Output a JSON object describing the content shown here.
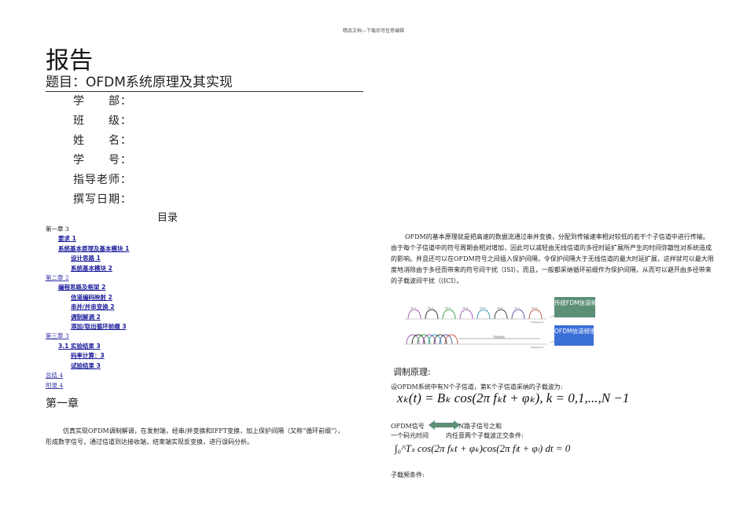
{
  "header": "精品文档---下载后可任意编辑",
  "title": "报告",
  "topic": "题目：OFDM系统原理及其实现",
  "fields": [
    "学　　部：",
    "班　　级：",
    "姓　　名：",
    "学　　号：",
    "指导老师：",
    "撰写日期："
  ],
  "toc": {
    "title": "目录",
    "items": [
      {
        "text": "第一章 3",
        "level": 0,
        "style": "plain"
      },
      {
        "text": "要求 1",
        "level": 1,
        "style": "bold"
      },
      {
        "text": "系统基本原理及基本模块 1",
        "level": 1,
        "style": "bold"
      },
      {
        "text": "设计思路 1",
        "level": 2,
        "style": "bold"
      },
      {
        "text": "系统基本模块 2",
        "level": 2,
        "style": "bold"
      },
      {
        "text": "第二章 2",
        "level": 0,
        "style": "link"
      },
      {
        "text": "编程思路及框架 2",
        "level": 1,
        "style": "bold"
      },
      {
        "text": "信道编码映射 2",
        "level": 2,
        "style": "bold"
      },
      {
        "text": "串并/并串变换 2",
        "level": 2,
        "style": "bold"
      },
      {
        "text": "调制解调 2",
        "level": 2,
        "style": "bold"
      },
      {
        "text": "添加/取出循环前缀 3",
        "level": 2,
        "style": "bold"
      },
      {
        "text": "第三章 3",
        "level": 0,
        "style": "link"
      },
      {
        "text": "3.1 实验结果 3",
        "level": 1,
        "style": "bold"
      },
      {
        "text": "码率计算：3",
        "level": 2,
        "style": "bold"
      },
      {
        "text": "试验结果 3",
        "level": 2,
        "style": "bold"
      },
      {
        "text": "总结 4",
        "level": 0,
        "style": "link"
      },
      {
        "text": "附录 4",
        "level": 0,
        "style": "link"
      }
    ]
  },
  "chapter1": {
    "heading": "第一章",
    "paragraph": "仿真实现OFDM调制解调，在发射端，经串/并变换和IFFT变换，加上保护间隔（又称“循环前缀”），形成数字信号，通过信道到达接收端，结束端实现反变换，进行误码分析。"
  },
  "right": {
    "paragraph": "OFDM的基本原理就是把高速的数据流通过串并变换，分配到传输速率相对较低的若干个子信道中进行传输。由于每个子信道中的符号周期会相对增加，因此可以减轻由无线信道的多径时延扩展所产生的时间弥散性对系统造成的影响。并且还可以在OFDM符号之间插入保护间隔，令保护间隔大于无线信道的最大时延扩展，这样就可以最大限度地消除由于多径而带来的符号间干扰（ISI）。而且，一般都采纳循环前缀作为保护间隔，从而可以避开由多径带来的子载波间干扰（(ICI）。",
    "figure": {
      "tag1": "传统FDM信道频谱划分",
      "tag2": "OFDM信道频谱划分",
      "channels": [
        "Ch.1",
        "Ch.2",
        "Ch.3",
        "Ch.4",
        "Ch.5",
        "Ch.6",
        "Ch.7",
        "Ch.8"
      ],
      "axis": "Frequency",
      "saving": "节省的带宽"
    },
    "subheading": "调制原理:",
    "line1": "设OFDM系统中有N个子信道，第K个子信道采纳的子载波为:",
    "formula1": "xₖ(t) = Bₖ cos(2π fₖt + φₖ), k = 0,1,...,N −1",
    "ofdm_label": "OFDM信号",
    "sum_label": "N路子信号之和",
    "line2a": "一个码元时间",
    "line2b": "内任意两个子载波正交条件:",
    "formula2": "∫₀^Tₛ cos(2π fₖt + φₖ)cos(2π fₗt + φₗ) dt = 0",
    "line3": "子载频条件:"
  },
  "colors": {
    "green": "#5b8f76",
    "blue": "#3b6fd8",
    "link": "#3a3aa8"
  }
}
